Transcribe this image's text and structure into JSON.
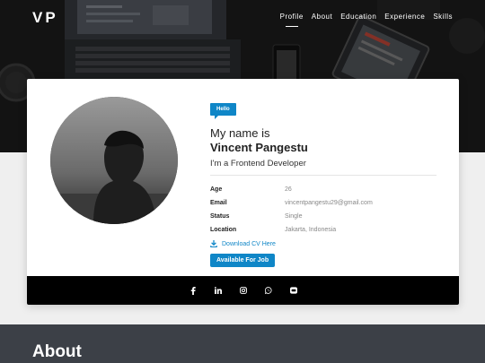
{
  "brand": {
    "logo": "VP"
  },
  "nav": [
    {
      "label": "Profile",
      "active": true
    },
    {
      "label": "About"
    },
    {
      "label": "Education"
    },
    {
      "label": "Experience"
    },
    {
      "label": "Skills"
    }
  ],
  "profile": {
    "badge": "Hello",
    "intro": "My name is",
    "name": "Vincent Pangestu",
    "role": "I'm a Frontend Developer",
    "details": [
      {
        "label": "Age",
        "value": "26"
      },
      {
        "label": "Email",
        "value": "vincentpangestu29@gmail.com"
      },
      {
        "label": "Status",
        "value": "Single"
      },
      {
        "label": "Location",
        "value": "Jakarta, Indonesia"
      }
    ],
    "download_label": "Download CV Here",
    "availability_label": "Available For Job"
  },
  "social": [
    {
      "icon": "facebook-icon"
    },
    {
      "icon": "linkedin-icon"
    },
    {
      "icon": "instagram-icon"
    },
    {
      "icon": "whatsapp-icon"
    },
    {
      "icon": "line-icon"
    }
  ],
  "about": {
    "title": "About"
  },
  "colors": {
    "accent": "#0f86c7",
    "hero": "#1f1f1f",
    "about_bg": "#3c4047"
  }
}
